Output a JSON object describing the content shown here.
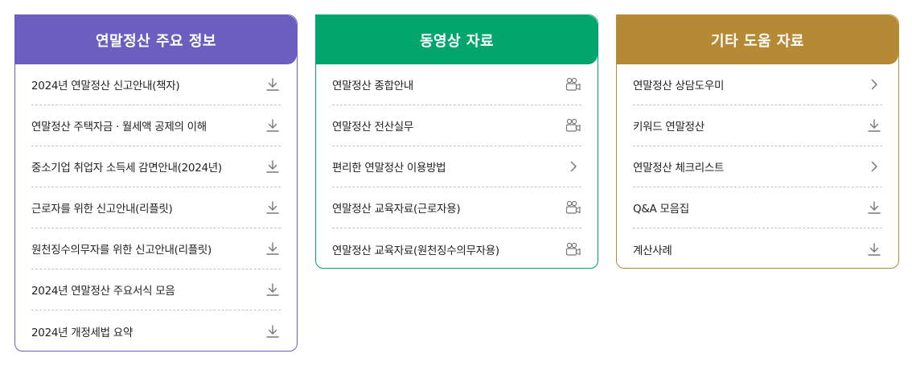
{
  "sections": [
    {
      "title": "연말정산 주요 정보",
      "items": [
        {
          "label": "2024년 연말정산 신고안내(책자)",
          "icon": "download-icon"
        },
        {
          "label": "연말정산 주택자금 · 월세액 공제의 이해",
          "icon": "download-icon"
        },
        {
          "label": "중소기업 취업자 소득세 감면안내(2024년)",
          "icon": "download-icon"
        },
        {
          "label": "근로자를 위한 신고안내(리플릿)",
          "icon": "download-icon"
        },
        {
          "label": "원천징수의무자를 위한 신고안내(리플릿)",
          "icon": "download-icon"
        },
        {
          "label": "2024년 연말정산 주요서식 모음",
          "icon": "download-icon"
        },
        {
          "label": "2024년 개정세법 요약",
          "icon": "download-icon"
        }
      ]
    },
    {
      "title": "동영상 자료",
      "items": [
        {
          "label": "연말정산 종합안내",
          "icon": "video-camera-icon"
        },
        {
          "label": "연말정산 전산실무",
          "icon": "video-camera-icon"
        },
        {
          "label": "편리한 연말정산 이용방법",
          "icon": "chevron-right-icon"
        },
        {
          "label": "연말정산 교육자료(근로자용)",
          "icon": "video-camera-icon"
        },
        {
          "label": "연말정산 교육자료(원천징수의무자용)",
          "icon": "video-camera-icon"
        }
      ]
    },
    {
      "title": "기타 도움 자료",
      "items": [
        {
          "label": "연말정산 상담도우미",
          "icon": "chevron-right-icon"
        },
        {
          "label": "키워드 연말정산",
          "icon": "download-icon"
        },
        {
          "label": "연말정산 체크리스트",
          "icon": "chevron-right-icon"
        },
        {
          "label": "Q&A 모음집",
          "icon": "download-icon"
        },
        {
          "label": "계산사례",
          "icon": "download-icon"
        }
      ]
    }
  ],
  "colors": {
    "purple": "#6a5fc1",
    "green": "#02a66d",
    "gold": "#b68a34",
    "icon": "#777777"
  }
}
